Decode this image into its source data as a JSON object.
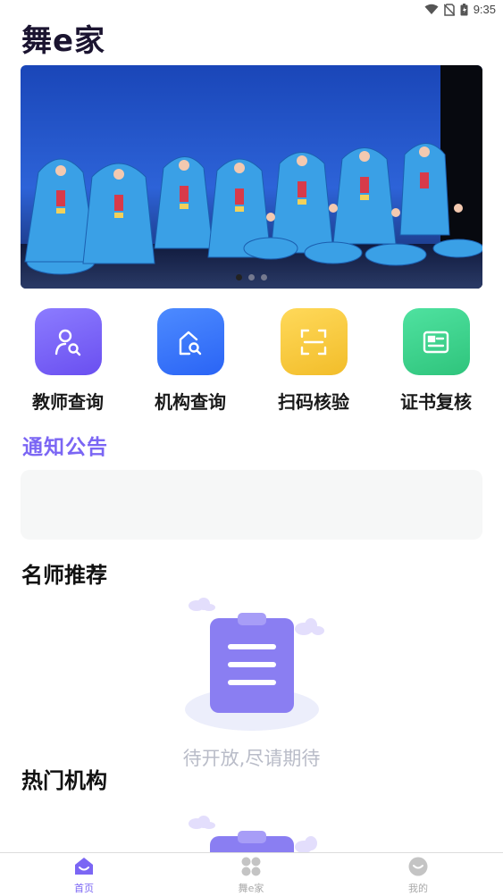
{
  "status_bar": {
    "time": "9:35"
  },
  "app": {
    "title": "舞e家"
  },
  "banner": {
    "slide_count": 3,
    "active_slide": 1
  },
  "quick_actions": [
    {
      "label": "教师查询",
      "icon": "teacher-search-icon",
      "color": "#7b66f4"
    },
    {
      "label": "机构查询",
      "icon": "institution-search-icon",
      "color": "#3f78ff"
    },
    {
      "label": "扫码核验",
      "icon": "scan-icon",
      "color": "#f6c93d"
    },
    {
      "label": "证书复核",
      "icon": "certificate-icon",
      "color": "#3fd58b"
    }
  ],
  "notice": {
    "title": "通知公告"
  },
  "sections": {
    "teachers": {
      "title": "名师推荐",
      "empty_text": "待开放,尽请期待"
    },
    "institutions": {
      "title": "热门机构"
    }
  },
  "tabbar": {
    "items": [
      {
        "label": "首页",
        "icon": "home-icon",
        "active": true
      },
      {
        "label": "舞e家",
        "icon": "grid-icon",
        "active": false
      },
      {
        "label": "我的",
        "icon": "profile-icon",
        "active": false
      }
    ]
  }
}
